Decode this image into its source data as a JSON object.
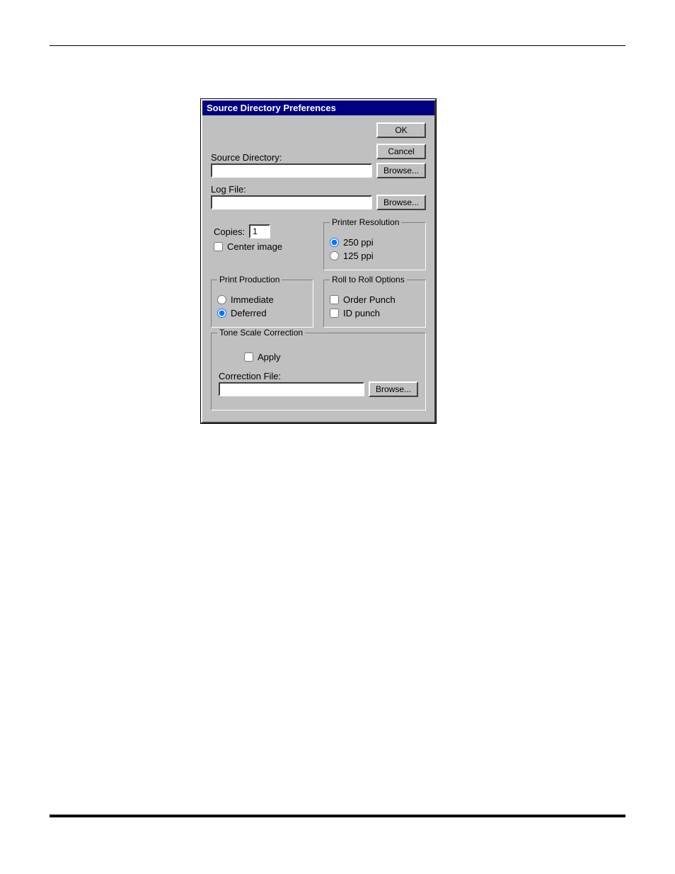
{
  "dialog": {
    "title": "Source Directory Preferences",
    "buttons": {
      "ok": "OK",
      "cancel": "Cancel",
      "browse": "Browse..."
    },
    "source_directory": {
      "label": "Source Directory:",
      "value": ""
    },
    "log_file": {
      "label": "Log File:",
      "value": ""
    },
    "copies": {
      "label": "Copies:",
      "value": "1"
    },
    "center_image": {
      "label": "Center image",
      "checked": false
    },
    "printer_resolution": {
      "legend": "Printer Resolution",
      "opt250": "250 ppi",
      "opt125": "125 ppi",
      "selected": "250"
    },
    "print_production": {
      "legend": "Print Production",
      "immediate": "Immediate",
      "deferred": "Deferred",
      "selected": "deferred"
    },
    "roll_options": {
      "legend": "Roll to Roll Options",
      "order_punch": {
        "label": "Order Punch",
        "checked": false
      },
      "id_punch": {
        "label": "ID punch",
        "checked": false
      }
    },
    "tone_scale": {
      "legend": "Tone Scale Correction",
      "apply": {
        "label": "Apply",
        "checked": false
      },
      "correction_file_label": "Correction File:",
      "correction_file_value": ""
    }
  }
}
